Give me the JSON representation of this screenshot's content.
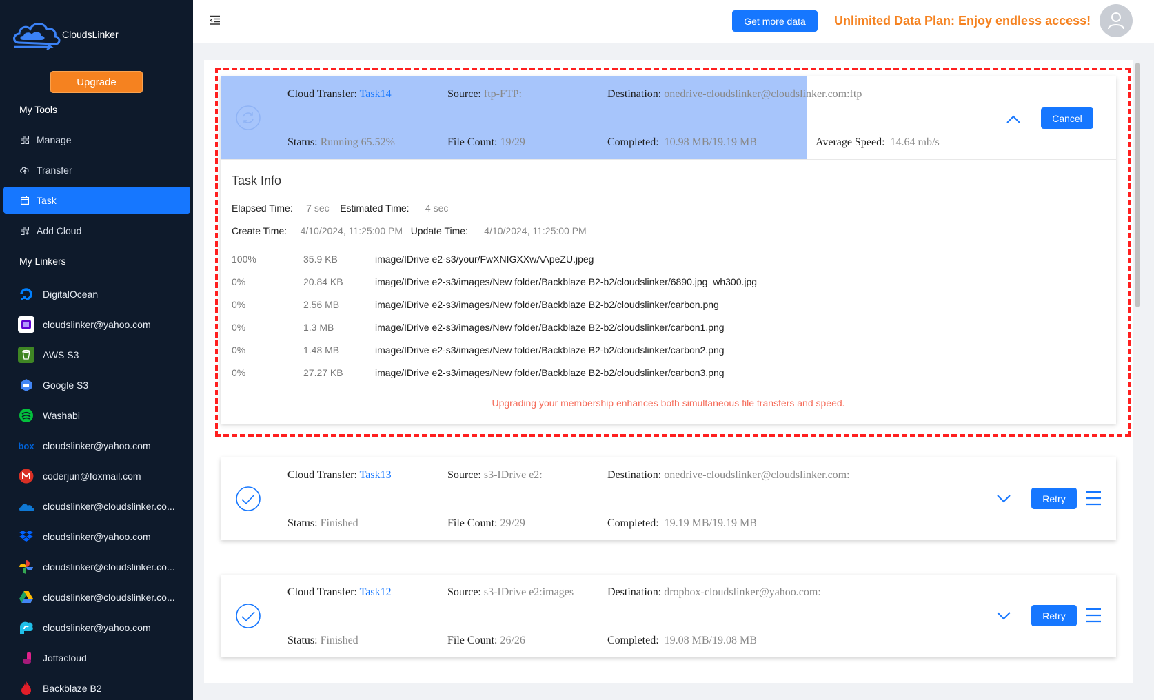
{
  "app": {
    "name": "CloudsLinker"
  },
  "sidebar": {
    "upgrade_label": "Upgrade",
    "my_tools_title": "My Tools",
    "tools": [
      {
        "label": "Manage",
        "icon": "grid-icon"
      },
      {
        "label": "Transfer",
        "icon": "cloud-upload-icon"
      },
      {
        "label": "Task",
        "icon": "calendar-icon",
        "active": true
      },
      {
        "label": "Add Cloud",
        "icon": "add-grid-icon"
      }
    ],
    "my_linkers_title": "My Linkers",
    "linkers": [
      {
        "label": "DigitalOcean",
        "icon": "digitalocean-icon",
        "color": "#0080ff"
      },
      {
        "label": "cloudslinker@yahoo.com",
        "icon": "yahoo-icon",
        "color": "#ffffff"
      },
      {
        "label": "AWS S3",
        "icon": "aws-s3-icon",
        "color": "#3f8624"
      },
      {
        "label": "Google S3",
        "icon": "google-cloud-icon",
        "color": "#4285f4"
      },
      {
        "label": "Washabi",
        "icon": "wasabi-icon",
        "color": "#03c03c"
      },
      {
        "label": "cloudslinker@yahoo.com",
        "icon": "box-icon",
        "color": "#0061d5"
      },
      {
        "label": "coderjun@foxmail.com",
        "icon": "gmail-icon",
        "color": "#d93025"
      },
      {
        "label": "cloudslinker@cloudslinker.co...",
        "icon": "onedrive-icon",
        "color": "#0f78d4"
      },
      {
        "label": "cloudslinker@yahoo.com",
        "icon": "dropbox-icon",
        "color": "#0061fe"
      },
      {
        "label": "cloudslinker@cloudslinker.co...",
        "icon": "google-photos-icon",
        "color": "#fbbc04"
      },
      {
        "label": "cloudslinker@cloudslinker.co...",
        "icon": "google-drive-icon",
        "color": "#1fa463"
      },
      {
        "label": "cloudslinker@yahoo.com",
        "icon": "pcloud-icon",
        "color": "#20bfe8"
      },
      {
        "label": "Jottacloud",
        "icon": "jottacloud-icon",
        "color": "#e0218a"
      },
      {
        "label": "Backblaze B2",
        "icon": "backblaze-icon",
        "color": "#e21e29"
      }
    ]
  },
  "header": {
    "get_more_data": "Get more data",
    "promo": "Unlimited Data Plan: Enjoy endless access!"
  },
  "tasks": [
    {
      "type_label": "Cloud Transfer:",
      "name": "Task14",
      "source_label": "Source:",
      "source": "ftp-FTP:",
      "destination_label": "Destination:",
      "destination": "onedrive-cloudslinker@cloudslinker.com:ftp",
      "status_label": "Status:",
      "status": "Running 65.52%",
      "progress": 0.6552,
      "file_count_label": "File Count:",
      "file_count": "19/29",
      "completed_label": "Completed:",
      "completed": "10.98 MB/19.19 MB",
      "speed_label": "Average Speed:",
      "speed": "14.64 mb/s",
      "action_label": "Cancel",
      "info": {
        "title": "Task Info",
        "elapsed_label": "Elapsed Time:",
        "elapsed": "7 sec",
        "estimated_label": "Estimated Time:",
        "estimated": "4 sec",
        "create_label": "Create Time:",
        "create": "4/10/2024, 11:25:00 PM",
        "update_label": "Update Time:",
        "update": "4/10/2024, 11:25:00 PM",
        "files": [
          {
            "pct": "100%",
            "size": "35.9 KB",
            "path": "image/IDrive e2-s3/your/FwXNIGXXwAApeZU.jpeg"
          },
          {
            "pct": "0%",
            "size": "20.84 KB",
            "path": "image/IDrive e2-s3/images/New folder/Backblaze B2-b2/cloudslinker/6890.jpg_wh300.jpg"
          },
          {
            "pct": "0%",
            "size": "2.56 MB",
            "path": "image/IDrive e2-s3/images/New folder/Backblaze B2-b2/cloudslinker/carbon.png"
          },
          {
            "pct": "0%",
            "size": "1.3 MB",
            "path": "image/IDrive e2-s3/images/New folder/Backblaze B2-b2/cloudslinker/carbon1.png"
          },
          {
            "pct": "0%",
            "size": "1.48 MB",
            "path": "image/IDrive e2-s3/images/New folder/Backblaze B2-b2/cloudslinker/carbon2.png"
          },
          {
            "pct": "0%",
            "size": "27.27 KB",
            "path": "image/IDrive e2-s3/images/New folder/Backblaze B2-b2/cloudslinker/carbon3.png"
          }
        ],
        "upgrade_note": "Upgrading your membership enhances both simultaneous file transfers and speed."
      }
    },
    {
      "type_label": "Cloud Transfer:",
      "name": "Task13",
      "source_label": "Source:",
      "source": "s3-IDrive e2:",
      "destination_label": "Destination:",
      "destination": "onedrive-cloudslinker@cloudslinker.com:",
      "status_label": "Status:",
      "status": "Finished",
      "file_count_label": "File Count:",
      "file_count": "29/29",
      "completed_label": "Completed:",
      "completed": "19.19 MB/19.19 MB",
      "action_label": "Retry"
    },
    {
      "type_label": "Cloud Transfer:",
      "name": "Task12",
      "source_label": "Source:",
      "source": "s3-IDrive e2:images",
      "destination_label": "Destination:",
      "destination": "dropbox-cloudslinker@yahoo.com:",
      "status_label": "Status:",
      "status": "Finished",
      "file_count_label": "File Count:",
      "file_count": "26/26",
      "completed_label": "Completed:",
      "completed": "19.08 MB/19.08 MB",
      "action_label": "Retry"
    }
  ],
  "colors": {
    "accent": "#1677ff",
    "sidebar_bg": "#0e1a2b",
    "orange": "#f58220",
    "highlight_border": "#ff1f1f",
    "progress_fill": "#a7c5fb"
  }
}
